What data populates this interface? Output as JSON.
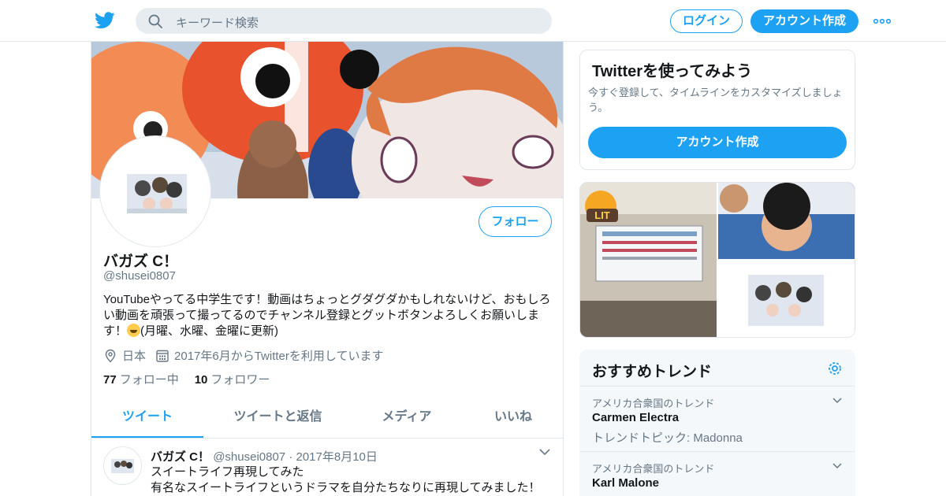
{
  "header": {
    "search_placeholder": "キーワード検索",
    "login_label": "ログイン",
    "signup_label": "アカウント作成"
  },
  "profile": {
    "follow_label": "フォロー",
    "name": "バガズ C！",
    "handle": "@shusei0807",
    "bio_part1": "YouTubeやってる中学生です！動画はちょっとグダグダかもしれないけど、おもしろい動画を頑張って撮ってるのでチャンネル登録とグットボタンよろしくお願いします！",
    "bio_part2": "(月曜、水曜、金曜に更新)",
    "location": "日本",
    "joined": "2017年6月からTwitterを利用しています",
    "following_count": "77",
    "following_label": "フォロー中",
    "followers_count": "10",
    "followers_label": "フォロワー"
  },
  "tabs": [
    {
      "label": "ツイート",
      "active": true
    },
    {
      "label": "ツイートと返信",
      "active": false
    },
    {
      "label": "メディア",
      "active": false
    },
    {
      "label": "いいね",
      "active": false
    }
  ],
  "tweet": {
    "name": "バガズ C！",
    "handle": "@shusei0807",
    "separator": "·",
    "date": "2017年8月10日",
    "line1": "スイートライフ再現してみた",
    "line2": "有名なスイートライフというドラマを自分たちなりに再現してみました！"
  },
  "welcome": {
    "title": "Twitterを使ってみよう",
    "description": "今すぐ登録して、タイムラインをカスタマイズしましょう。",
    "button_label": "アカウント作成"
  },
  "media": {
    "badge": "LIT"
  },
  "trends": {
    "title": "おすすめトレンド",
    "items": [
      {
        "context": "アメリカ合衆国のトレンド",
        "name": "Carmen Electra",
        "meta": "トレンドトピック: Madonna"
      },
      {
        "context": "アメリカ合衆国のトレンド",
        "name": "Karl Malone",
        "meta": ""
      }
    ]
  },
  "colors": {
    "brand": "#1da1f2",
    "secondary_text": "#657786",
    "border": "#e1e8ed"
  },
  "icons": [
    "twitter-bird-icon",
    "search-icon",
    "more-dots-icon",
    "location-pin-icon",
    "calendar-icon",
    "chevron-down-icon",
    "gear-icon"
  ]
}
